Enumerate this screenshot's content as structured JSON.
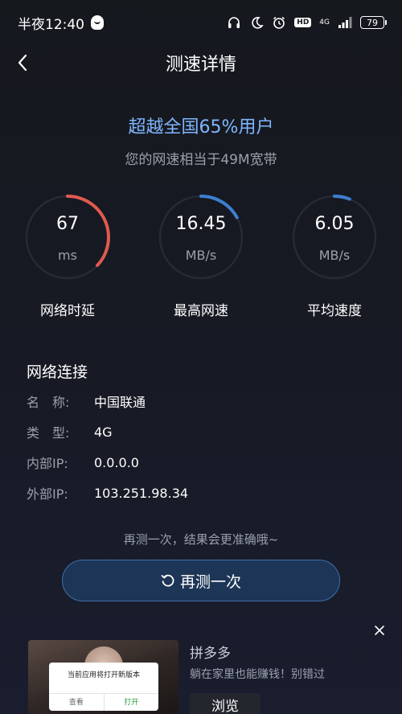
{
  "status_bar": {
    "time": "半夜12:40",
    "network": "4G",
    "battery": "79"
  },
  "header": {
    "title": "测速详情"
  },
  "summary": {
    "headline": "超越全国65%用户",
    "subline": "您的网速相当于49M宽带"
  },
  "gauges": [
    {
      "value": "67",
      "unit": "ms",
      "label": "网络时延",
      "fill": 0.37,
      "color": "#e05a4f"
    },
    {
      "value": "16.45",
      "unit": "MB/s",
      "label": "最高网速",
      "fill": 0.17,
      "color": "#3d7fd0"
    },
    {
      "value": "6.05",
      "unit": "MB/s",
      "label": "平均速度",
      "fill": 0.06,
      "color": "#3d7fd0"
    }
  ],
  "connection": {
    "title": "网络连接",
    "rows": [
      {
        "key": "名　称:",
        "value": "中国联通"
      },
      {
        "key": "类　型:",
        "value": "4G"
      },
      {
        "key": "内部IP:",
        "value": "0.0.0.0"
      },
      {
        "key": "外部IP:",
        "value": "103.251.98.34"
      }
    ]
  },
  "retest": {
    "hint": "再测一次，结果会更准确哦~",
    "button_label": "再测一次"
  },
  "ad": {
    "dialog_text": "当前应用将打开新版本",
    "dialog_cancel": "查看",
    "dialog_ok": "打开",
    "brand": "拼多多",
    "description": "躺在家里也能赚钱！别错过",
    "cta": "浏览"
  }
}
